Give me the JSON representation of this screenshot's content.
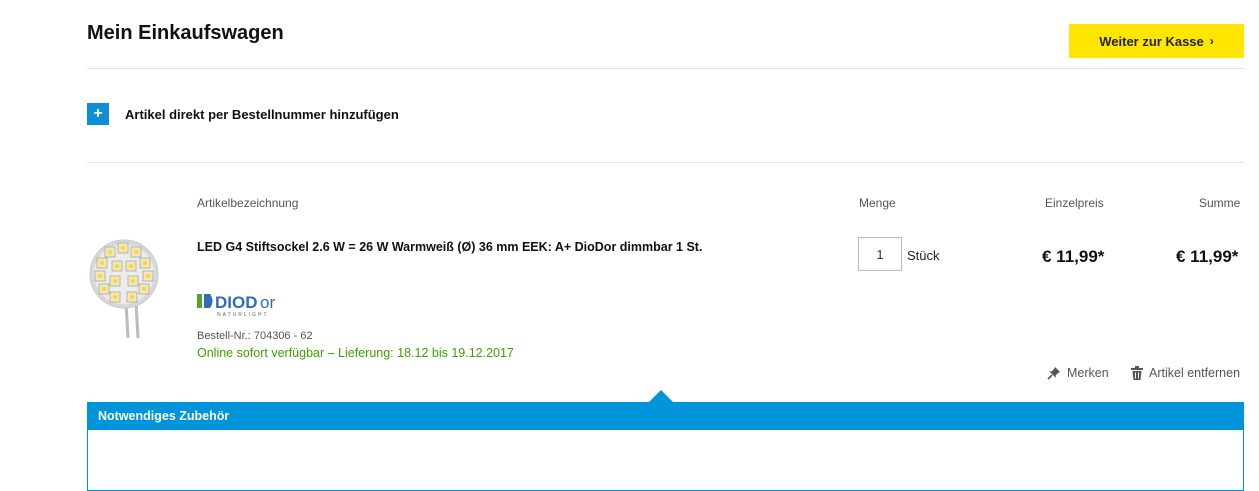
{
  "page": {
    "title": "Mein Einkaufswagen",
    "checkout_label": "Weiter zur Kasse",
    "add_by_number_label": "Artikel direkt per Bestellnummer hinzufügen"
  },
  "table_headers": {
    "description": "Artikelbezeichnung",
    "quantity": "Menge",
    "unit_price": "Einzelpreis",
    "total": "Summe"
  },
  "item": {
    "name": "LED G4 Stiftsockel 2.6 W = 26 W Warmweiß (Ø) 36 mm EEK: A+ DioDor dimmbar 1 St.",
    "brand": "DIODOR",
    "brand_tagline": "NATURLIGHT",
    "order_number": "Bestell-Nr.: 704306 - 62",
    "availability": "Online sofort verfügbar – Lieferung: 18.12 bis 19.12.2017",
    "quantity": "1",
    "unit": "Stück",
    "unit_price": "€ 11,99*",
    "total_price": "€ 11,99*"
  },
  "actions": {
    "remember": "Merken",
    "remove": "Artikel entfernen"
  },
  "accessories": {
    "title": "Notwendiges Zubehör"
  },
  "colors": {
    "accent_blue": "#0094da",
    "checkout_yellow": "#ffe600",
    "availability_green": "#3ea100"
  }
}
